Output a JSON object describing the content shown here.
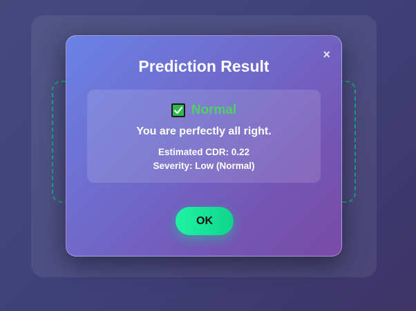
{
  "modal": {
    "title": "Prediction Result",
    "close_label": "×",
    "status": {
      "icon": "check-mark-icon",
      "label": "Normal",
      "color": "#4fd067"
    },
    "message": "You are perfectly all right.",
    "cdr_text": "Estimated CDR: 0.22",
    "severity_text": "Severity: Low (Normal)",
    "ok_label": "OK"
  },
  "colors": {
    "modal_gradient_start": "#6a82e5",
    "modal_gradient_end": "#7a4aa6",
    "ok_button": "#1ff3a5",
    "dashed_border": "#19a583"
  }
}
